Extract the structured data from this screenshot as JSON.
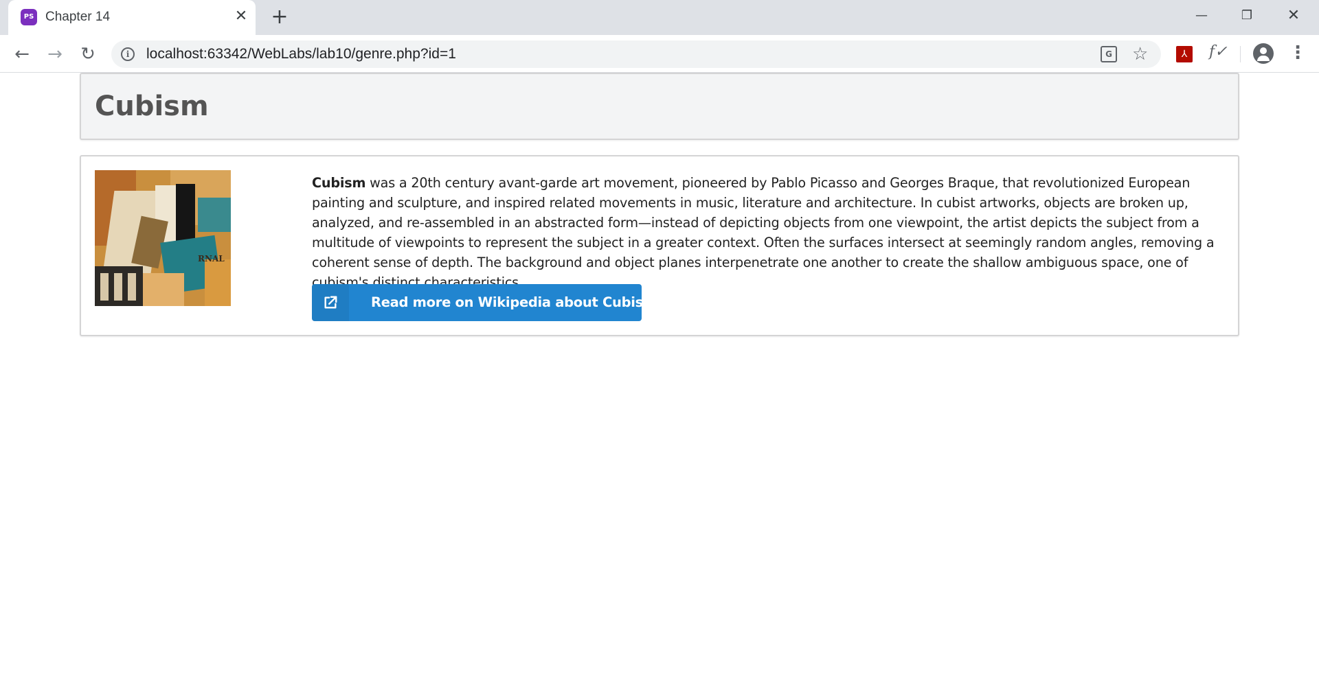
{
  "browser": {
    "tab": {
      "title": "Chapter 14",
      "favicon_text": "PS"
    },
    "url": "localhost:63342/WebLabs/lab10/genre.php?id=1",
    "icons": {
      "back": "arrow-left-icon",
      "forward": "arrow-right-icon",
      "reload": "reload-icon",
      "info": "info-icon",
      "translate": "translate-icon",
      "bookmark": "star-icon",
      "pdf": "pdf-icon",
      "formula": "fx-icon",
      "profile": "avatar-icon",
      "menu": "kebab-menu-icon"
    }
  },
  "page": {
    "title": "Cubism",
    "description": {
      "term": "Cubism",
      "text": " was a 20th century avant-garde art movement, pioneered by Pablo Picasso and Georges Braque, that revolutionized European painting and sculpture, and inspired related movements in music, literature and architecture. In cubist artworks, objects are broken up, analyzed, and re-assembled in an abstracted form—instead of depicting objects from one viewpoint, the artist depicts the subject from a multitude of viewpoints to represent the subject in a greater context. Often the surfaces intersect at seemingly random angles, removing a coherent sense of depth. The background and object planes interpenetrate one another to create the shallow ambiguous space, one of cubism's distinct characteristics."
    },
    "wiki_button": {
      "label": "Read more on Wikipedia about Cubism",
      "icon": "external-link-icon",
      "color": "#2185d0"
    },
    "artwork": {
      "caption_fragment": "RNAL"
    }
  }
}
